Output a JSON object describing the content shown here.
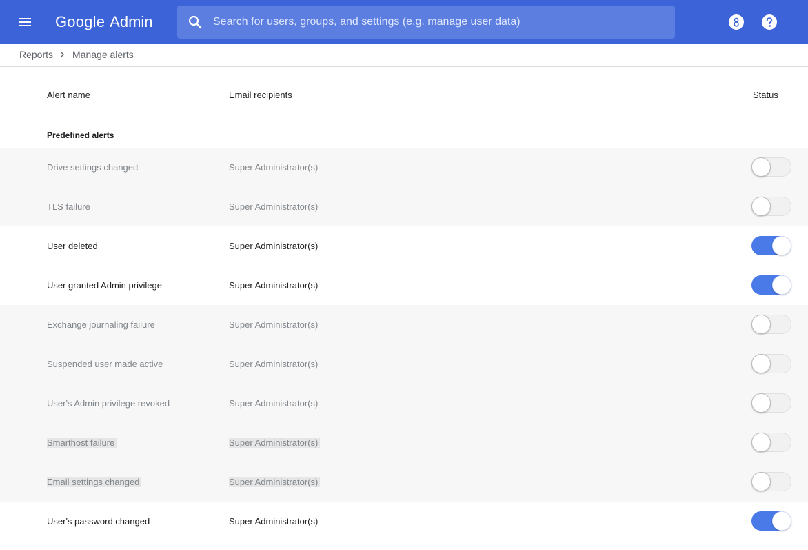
{
  "header": {
    "brand": "Google",
    "product": "Admin",
    "search_placeholder": "Search for users, groups, and settings (e.g. manage user data)",
    "bg_color": "#3c64d8",
    "icons": [
      "menu-icon",
      "search-icon",
      "user-badge-icon",
      "help-icon"
    ]
  },
  "breadcrumb": {
    "parent": "Reports",
    "current": "Manage alerts"
  },
  "table": {
    "columns": {
      "name": "Alert name",
      "recipients": "Email recipients",
      "status": "Status"
    },
    "section_title": "Predefined alerts",
    "rows": [
      {
        "name": "Drive settings changed",
        "recipients": "Super Administrator(s)",
        "enabled": false,
        "highlighted": false
      },
      {
        "name": "TLS failure",
        "recipients": "Super Administrator(s)",
        "enabled": false,
        "highlighted": false
      },
      {
        "name": "User deleted",
        "recipients": "Super Administrator(s)",
        "enabled": true,
        "highlighted": false
      },
      {
        "name": "User granted Admin privilege",
        "recipients": "Super Administrator(s)",
        "enabled": true,
        "highlighted": false
      },
      {
        "name": "Exchange journaling failure",
        "recipients": "Super Administrator(s)",
        "enabled": false,
        "highlighted": false
      },
      {
        "name": "Suspended user made active",
        "recipients": "Super Administrator(s)",
        "enabled": false,
        "highlighted": false
      },
      {
        "name": "User's Admin privilege revoked",
        "recipients": "Super Administrator(s)",
        "enabled": false,
        "highlighted": false
      },
      {
        "name": "Smarthost failure",
        "recipients": "Super Administrator(s)",
        "enabled": false,
        "highlighted": true
      },
      {
        "name": "Email settings changed",
        "recipients": "Super Administrator(s)",
        "enabled": false,
        "highlighted": true
      },
      {
        "name": "User's password changed",
        "recipients": "Super Administrator(s)",
        "enabled": true,
        "highlighted": false
      }
    ]
  },
  "colors": {
    "toggle_on": "#4a7ae8",
    "toggle_off_track": "#f1f1f1",
    "disabled_row_bg": "#f7f7f7"
  }
}
